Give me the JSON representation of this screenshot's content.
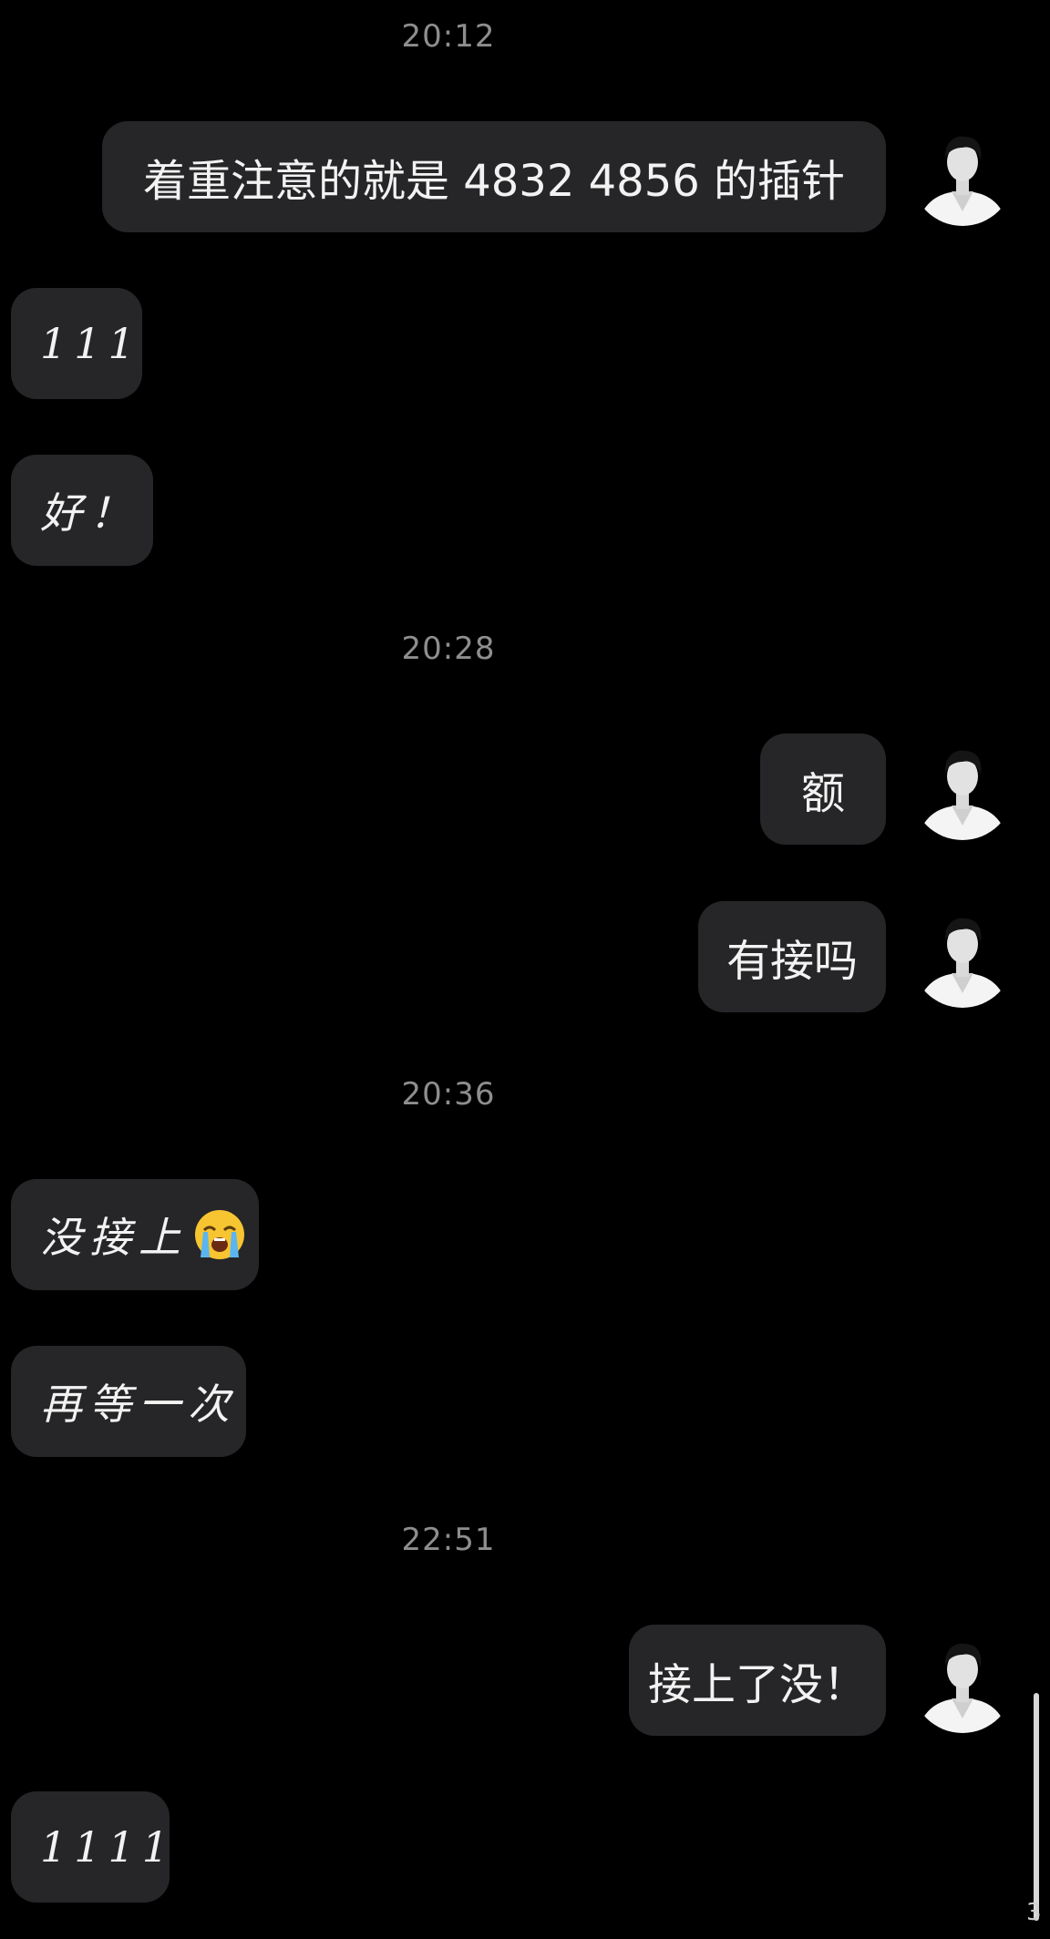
{
  "chat": {
    "timestamps": [
      "20:12",
      "20:28",
      "20:36",
      "22:51"
    ],
    "messages": [
      {
        "direction": "outgoing",
        "text": "着重注意的就是 4832  4856 的插针"
      },
      {
        "direction": "incoming",
        "text": "111"
      },
      {
        "direction": "incoming",
        "text": "好！"
      },
      {
        "direction": "outgoing",
        "text": "额"
      },
      {
        "direction": "outgoing",
        "text": "有接吗"
      },
      {
        "direction": "incoming",
        "text": "没接上",
        "emoji": "loudly-crying-face-emoji"
      },
      {
        "direction": "incoming",
        "text": "再等一次"
      },
      {
        "direction": "outgoing",
        "text": "接上了没！"
      },
      {
        "direction": "incoming",
        "text": "1111"
      }
    ]
  },
  "corner_mark": "3",
  "colors": {
    "background": "#000000",
    "bubble": "#262628",
    "text": "#f2f2f2",
    "timestamp": "#8e8e8e"
  },
  "icons": {
    "avatar": "user-avatar-photo",
    "emoji": "loudly-crying-face-emoji"
  }
}
